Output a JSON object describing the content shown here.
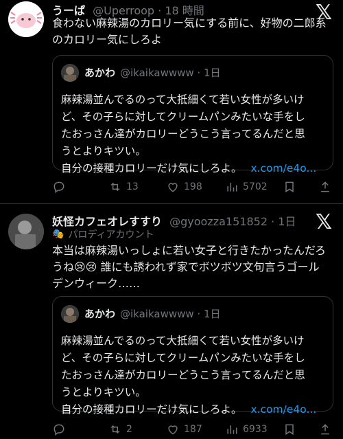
{
  "posts": [
    {
      "display_name": "うーぱ",
      "handle_time": "@Uperroop · 18 時間",
      "text_lines": [
        "食わない麻辣湯のカロリー気にする前に、好物の二郎系",
        "のカロリー気にしろよ"
      ],
      "quote": {
        "display_name": "あかわ",
        "handle_time": "@ikaikawwww · 1日",
        "text_lines": [
          "麻辣湯並んでるのって大抵細くて若い女性が多いけ",
          "ど、その子らに対してクリームパンみたいな手をし",
          "たおっさん達がカロリーどうこう言ってるんだと思",
          "うとよりキツい。"
        ],
        "last_line": "自分の接種カロリーだけ気にしろよ。",
        "link": "x.com/e4o..."
      },
      "stats": {
        "replies": "",
        "reposts": "13",
        "likes": "198",
        "views": "5702"
      }
    },
    {
      "display_name": "妖怪カフェオレすすり",
      "handle_time": "@gyoozza151852 · 1日",
      "subtitle": "パロディアカウント",
      "text_lines": [
        "本当は麻辣湯いっしょに若い女子と行きたかったんだろ",
        "うね😢😢 誰にも誘われず家でボツボツ文句言うゴール",
        "デンウィーク……"
      ],
      "quote": {
        "display_name": "あかわ",
        "handle_time": "@ikaikawwww · 1日",
        "text_lines": [
          "麻辣湯並んでるのって大抵細くて若い女性が多いけ",
          "ど、その子らに対してクリームパンみたいな手をし",
          "たおっさん達がカロリーどうこう言ってるんだと思",
          "うとよりキツい。"
        ],
        "last_line": "自分の接種カロリーだけ気にしろよ。",
        "link": "x.com/e4o..."
      },
      "stats": {
        "replies": "",
        "reposts": "2",
        "likes": "187",
        "views": "6933"
      }
    }
  ],
  "colors": {
    "background": "#000000",
    "text": "#e7e9ea",
    "muted": "#71767b",
    "link": "#1d9bf0",
    "border": "#2f3336"
  },
  "icons": [
    "reply-icon",
    "repost-icon",
    "like-icon",
    "views-icon",
    "bookmark-icon",
    "share-icon",
    "x-logo-icon",
    "mask-icon"
  ]
}
